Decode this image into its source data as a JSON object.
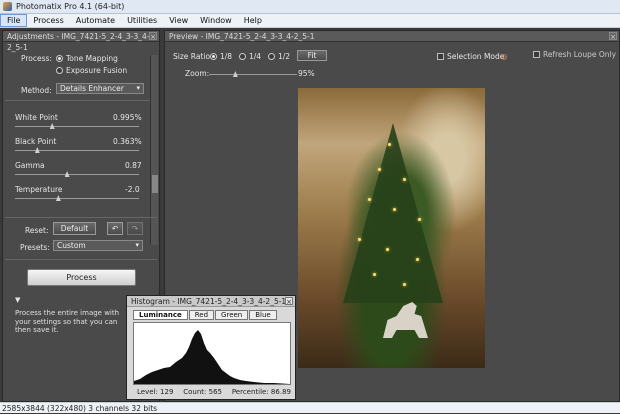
{
  "window": {
    "title": "Photomatix Pro 4.1 (64-bit)"
  },
  "menu": [
    "File",
    "Process",
    "Automate",
    "Utilities",
    "View",
    "Window",
    "Help"
  ],
  "adjustments": {
    "header": "Adjustments - IMG_7421-5_2-4_3-3_4-2_5-1",
    "process_label": "Process:",
    "tone_mapping": "Tone Mapping",
    "exposure_fusion": "Exposure Fusion",
    "method_label": "Method:",
    "method_value": "Details Enhancer",
    "sliders": [
      {
        "label": "White Point",
        "value": "0.995%",
        "level": 0.3
      },
      {
        "label": "Black Point",
        "value": "0.363%",
        "level": 0.18
      },
      {
        "label": "Gamma",
        "value": "0.87",
        "level": 0.42
      },
      {
        "label": "Temperature",
        "value": "-2.0",
        "level": 0.35
      }
    ],
    "reset_label": "Reset:",
    "default_button": "Default",
    "presets_label": "Presets:",
    "presets_value": "Custom",
    "process_button": "Process",
    "description": "Process the entire image with your settings so that you can then save it."
  },
  "preview": {
    "header": "Preview - IMG_7421-5_2-4_3-3_4-2_5-1",
    "size_ratio_label": "Size Ratio:",
    "ratios": [
      "1/8",
      "1/4",
      "1/2"
    ],
    "fit_button": "Fit",
    "selection_mode": "Selection Mode",
    "refresh_loupe": "Refresh Loupe Only",
    "zoom_label": "Zoom:",
    "zoom_value": "95%",
    "zoom_level": 0.3
  },
  "histogram": {
    "header": "Histogram - IMG_7421-5_2-4_3-3_4-2_5-1",
    "tabs": [
      "Luminance",
      "Red",
      "Green",
      "Blue"
    ],
    "level": "Level: 129",
    "count": "Count: 565",
    "percentile": "Percentile: 86.89"
  },
  "status": "2585x3844 (322x480) 3 channels 32 bits"
}
